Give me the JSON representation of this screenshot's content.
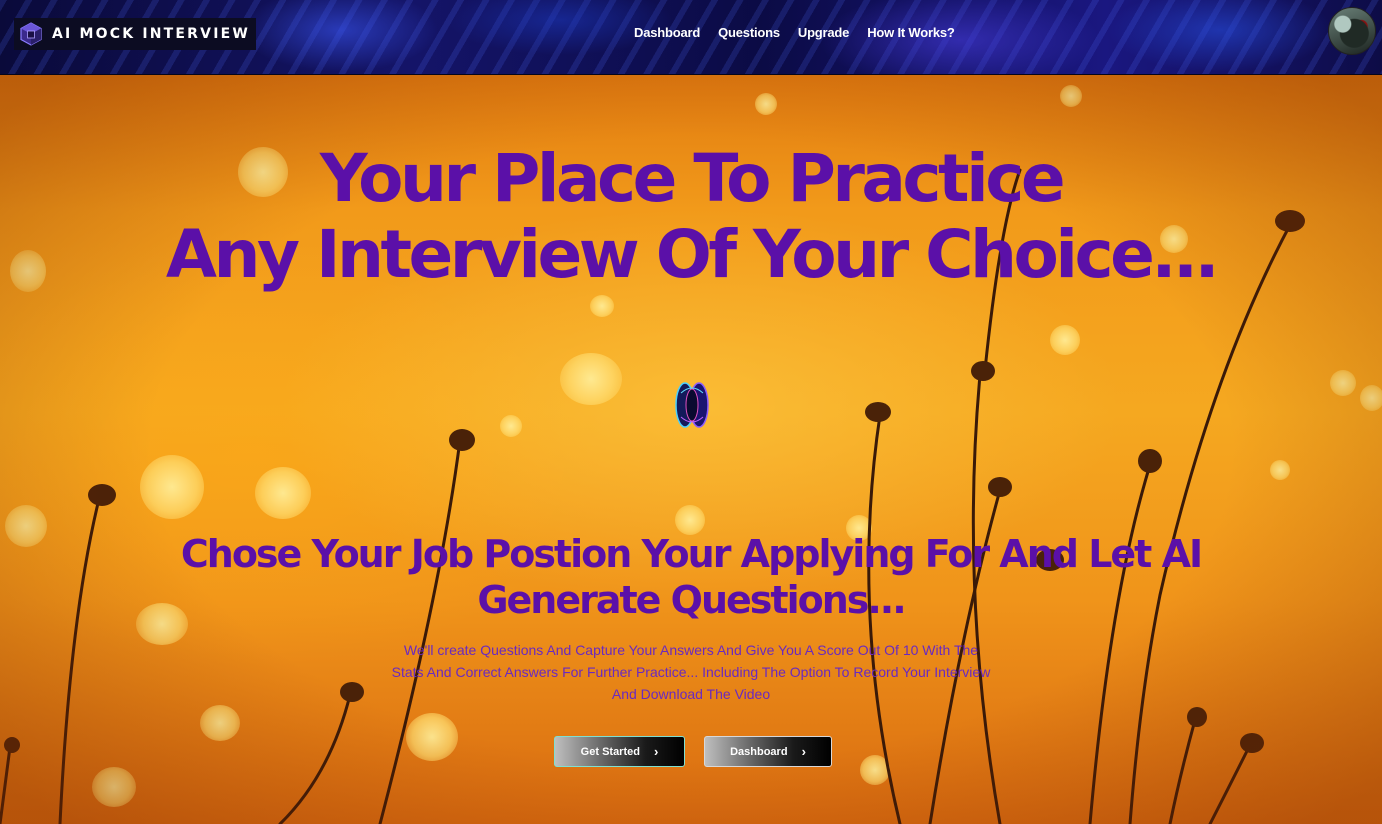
{
  "brand": {
    "logo_icon": "cube-logo-icon",
    "name": "AI MOCK INTERVIEW"
  },
  "nav": {
    "links": [
      {
        "label": "Dashboard"
      },
      {
        "label": "Questions"
      },
      {
        "label": "Upgrade"
      },
      {
        "label": "How It Works?"
      }
    ],
    "avatar_icon": "user-avatar"
  },
  "hero": {
    "headline_line1": "Your Place To Practice",
    "headline_line2": "Any Interview Of Your Choice...",
    "loader_icon": "loading-animation-icon",
    "subheading_line1": "Chose Your Job Postion Your Applying For And Let AI",
    "subheading_line2": "Generate Questions...",
    "description": "We'll create Questions And Capture Your Answers And Give You A Score Out Of 10 With The Stats And Correct Answers For Further Practice... Including The Option To Record Your Interview And Download The Video",
    "buttons": {
      "get_started_label": "Get Started",
      "dashboard_label": "Dashboard",
      "chevron_icon": "chevron-right-icon"
    }
  },
  "colors": {
    "headline": "#5b10a8",
    "description": "#6a2ac0",
    "nav_bg": "#0b0b45",
    "hero_orange": "#f5a820"
  }
}
